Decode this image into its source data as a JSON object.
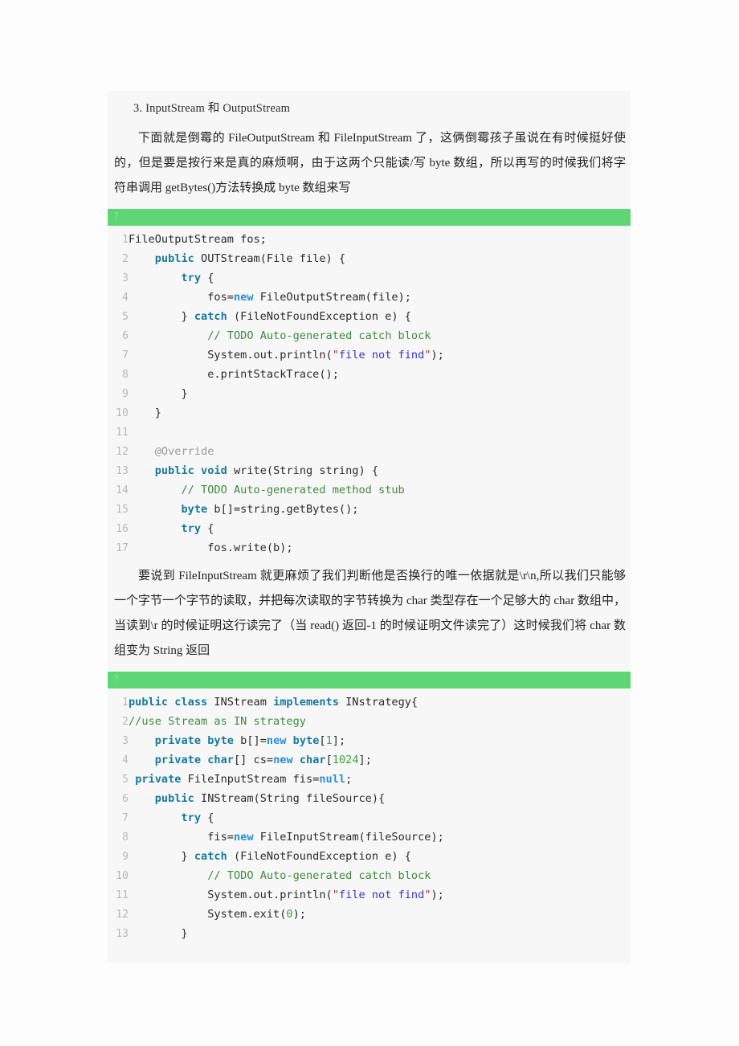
{
  "document": {
    "section_heading": "3. InputStream 和 OutputStream",
    "paragraph_1": "下面就是倒霉的 FileOutputStream 和 FileInputStream 了，这俩倒霉孩子虽说在有时候挺好使的，但是要是按行来是真的麻烦啊，由于这两个只能读/写 byte 数组，所以再写的时候我们将字符串调用 getBytes()方法转换成 byte 数组来写",
    "paragraph_2": "要说到 FileInputStream 就更麻烦了我们判断他是否换行的唯一依据就是\\r\\n,所以我们只能够一个字节一个字节的读取，并把每次读取的字节转换为 char 类型存在一个足够大的 char 数组中，当读到\\r 的时候证明这行读完了（当 read() 返回-1 的时候证明文件读完了）这时候我们将 char 数组变为 String 返回"
  },
  "colors": {
    "code_bar_green": "#5fd675",
    "code_background": "#f7f7f7",
    "page_background": "#fdfdfd",
    "keyword_teal": "#17799c",
    "keyword_blue": "#2a8fd8",
    "comment_green": "#3c8c3c",
    "string_blue": "#3434cc",
    "number_green": "#3fa33f",
    "annotation_gray": "#9a9a9a",
    "line_number_gray": "#b9b9b9"
  },
  "code_blocks": [
    {
      "toolbar_glyph": "?",
      "language": "java",
      "lines": [
        {
          "n": "1",
          "tokens": [
            {
              "t": "plain",
              "v": "FileOutputStream fos;"
            }
          ]
        },
        {
          "n": "2",
          "tokens": [
            {
              "t": "plain",
              "v": "    "
            },
            {
              "t": "kw",
              "v": "public"
            },
            {
              "t": "plain",
              "v": " OUTStream(File file) {"
            }
          ]
        },
        {
          "n": "3",
          "tokens": [
            {
              "t": "plain",
              "v": "        "
            },
            {
              "t": "kw",
              "v": "try"
            },
            {
              "t": "plain",
              "v": " {"
            }
          ]
        },
        {
          "n": "4",
          "tokens": [
            {
              "t": "plain",
              "v": "            fos="
            },
            {
              "t": "kw2",
              "v": "new"
            },
            {
              "t": "plain",
              "v": " FileOutputStream(file);"
            }
          ]
        },
        {
          "n": "5",
          "tokens": [
            {
              "t": "plain",
              "v": "        } "
            },
            {
              "t": "kw",
              "v": "catch"
            },
            {
              "t": "plain",
              "v": " (FileNotFoundException e) {"
            }
          ]
        },
        {
          "n": "6",
          "tokens": [
            {
              "t": "plain",
              "v": "            "
            },
            {
              "t": "cmt",
              "v": "// TODO Auto-generated catch block"
            }
          ]
        },
        {
          "n": "7",
          "tokens": [
            {
              "t": "plain",
              "v": "            System.out.println("
            },
            {
              "t": "quo",
              "v": "\""
            },
            {
              "t": "str",
              "v": "file not find"
            },
            {
              "t": "quo",
              "v": "\""
            },
            {
              "t": "plain",
              "v": ");"
            }
          ]
        },
        {
          "n": "8",
          "tokens": [
            {
              "t": "plain",
              "v": "            e.printStackTrace();"
            }
          ]
        },
        {
          "n": "9",
          "tokens": [
            {
              "t": "plain",
              "v": "        }"
            }
          ]
        },
        {
          "n": "10",
          "tokens": [
            {
              "t": "plain",
              "v": "    }"
            }
          ]
        },
        {
          "n": "11",
          "tokens": [
            {
              "t": "plain",
              "v": ""
            }
          ]
        },
        {
          "n": "12",
          "tokens": [
            {
              "t": "plain",
              "v": "    "
            },
            {
              "t": "ann",
              "v": "@Override"
            }
          ]
        },
        {
          "n": "13",
          "tokens": [
            {
              "t": "plain",
              "v": "    "
            },
            {
              "t": "kw",
              "v": "public"
            },
            {
              "t": "plain",
              "v": " "
            },
            {
              "t": "kw",
              "v": "void"
            },
            {
              "t": "plain",
              "v": " write(String string) {"
            }
          ]
        },
        {
          "n": "14",
          "tokens": [
            {
              "t": "plain",
              "v": "        "
            },
            {
              "t": "cmt",
              "v": "// TODO Auto-generated method stub"
            }
          ]
        },
        {
          "n": "15",
          "tokens": [
            {
              "t": "plain",
              "v": "        "
            },
            {
              "t": "kw",
              "v": "byte"
            },
            {
              "t": "plain",
              "v": " b[]=string.getBytes();"
            }
          ]
        },
        {
          "n": "16",
          "tokens": [
            {
              "t": "plain",
              "v": "        "
            },
            {
              "t": "kw",
              "v": "try"
            },
            {
              "t": "plain",
              "v": " {"
            }
          ]
        },
        {
          "n": "17",
          "tokens": [
            {
              "t": "plain",
              "v": "            fos.write(b);"
            }
          ]
        }
      ]
    },
    {
      "toolbar_glyph": "?",
      "language": "java",
      "lines": [
        {
          "n": "1",
          "tokens": [
            {
              "t": "kw",
              "v": "public"
            },
            {
              "t": "plain",
              "v": " "
            },
            {
              "t": "kw",
              "v": "class"
            },
            {
              "t": "plain",
              "v": " INStream "
            },
            {
              "t": "kw",
              "v": "implements"
            },
            {
              "t": "plain",
              "v": " INstrategy{"
            }
          ]
        },
        {
          "n": "2",
          "tokens": [
            {
              "t": "cmt",
              "v": "//use Stream as IN strategy"
            }
          ]
        },
        {
          "n": "3",
          "tokens": [
            {
              "t": "plain",
              "v": "    "
            },
            {
              "t": "kw",
              "v": "private"
            },
            {
              "t": "plain",
              "v": " "
            },
            {
              "t": "kw",
              "v": "byte"
            },
            {
              "t": "plain",
              "v": " b[]="
            },
            {
              "t": "kw2",
              "v": "new"
            },
            {
              "t": "plain",
              "v": " "
            },
            {
              "t": "kw",
              "v": "byte"
            },
            {
              "t": "plain",
              "v": "["
            },
            {
              "t": "num",
              "v": "1"
            },
            {
              "t": "plain",
              "v": "];"
            }
          ]
        },
        {
          "n": "4",
          "tokens": [
            {
              "t": "plain",
              "v": "    "
            },
            {
              "t": "kw",
              "v": "private"
            },
            {
              "t": "plain",
              "v": " "
            },
            {
              "t": "kw",
              "v": "char"
            },
            {
              "t": "plain",
              "v": "[] cs="
            },
            {
              "t": "kw2",
              "v": "new"
            },
            {
              "t": "plain",
              "v": " "
            },
            {
              "t": "kw",
              "v": "char"
            },
            {
              "t": "plain",
              "v": "["
            },
            {
              "t": "num",
              "v": "1024"
            },
            {
              "t": "plain",
              "v": "];"
            }
          ]
        },
        {
          "n": "5",
          "tokens": [
            {
              "t": "plain",
              "v": " "
            },
            {
              "t": "kw",
              "v": "private"
            },
            {
              "t": "plain",
              "v": " FileInputStream fis="
            },
            {
              "t": "kw2",
              "v": "null"
            },
            {
              "t": "plain",
              "v": ";"
            }
          ]
        },
        {
          "n": "6",
          "tokens": [
            {
              "t": "plain",
              "v": "    "
            },
            {
              "t": "kw",
              "v": "public"
            },
            {
              "t": "plain",
              "v": " INStream(String fileSource){"
            }
          ]
        },
        {
          "n": "7",
          "tokens": [
            {
              "t": "plain",
              "v": "        "
            },
            {
              "t": "kw",
              "v": "try"
            },
            {
              "t": "plain",
              "v": " {"
            }
          ]
        },
        {
          "n": "8",
          "tokens": [
            {
              "t": "plain",
              "v": "            fis="
            },
            {
              "t": "kw2",
              "v": "new"
            },
            {
              "t": "plain",
              "v": " FileInputStream(fileSource);"
            }
          ]
        },
        {
          "n": "9",
          "tokens": [
            {
              "t": "plain",
              "v": "        } "
            },
            {
              "t": "kw",
              "v": "catch"
            },
            {
              "t": "plain",
              "v": " (FileNotFoundException e) {"
            }
          ]
        },
        {
          "n": "10",
          "tokens": [
            {
              "t": "plain",
              "v": "            "
            },
            {
              "t": "cmt",
              "v": "// TODO Auto-generated catch block"
            }
          ]
        },
        {
          "n": "11",
          "tokens": [
            {
              "t": "plain",
              "v": "            System.out.println("
            },
            {
              "t": "quo",
              "v": "\""
            },
            {
              "t": "str",
              "v": "file not find"
            },
            {
              "t": "quo",
              "v": "\""
            },
            {
              "t": "plain",
              "v": ");"
            }
          ]
        },
        {
          "n": "12",
          "tokens": [
            {
              "t": "plain",
              "v": "            System.exit("
            },
            {
              "t": "num",
              "v": "0"
            },
            {
              "t": "plain",
              "v": ");"
            }
          ]
        },
        {
          "n": "13",
          "tokens": [
            {
              "t": "plain",
              "v": "        }"
            }
          ]
        }
      ]
    }
  ]
}
